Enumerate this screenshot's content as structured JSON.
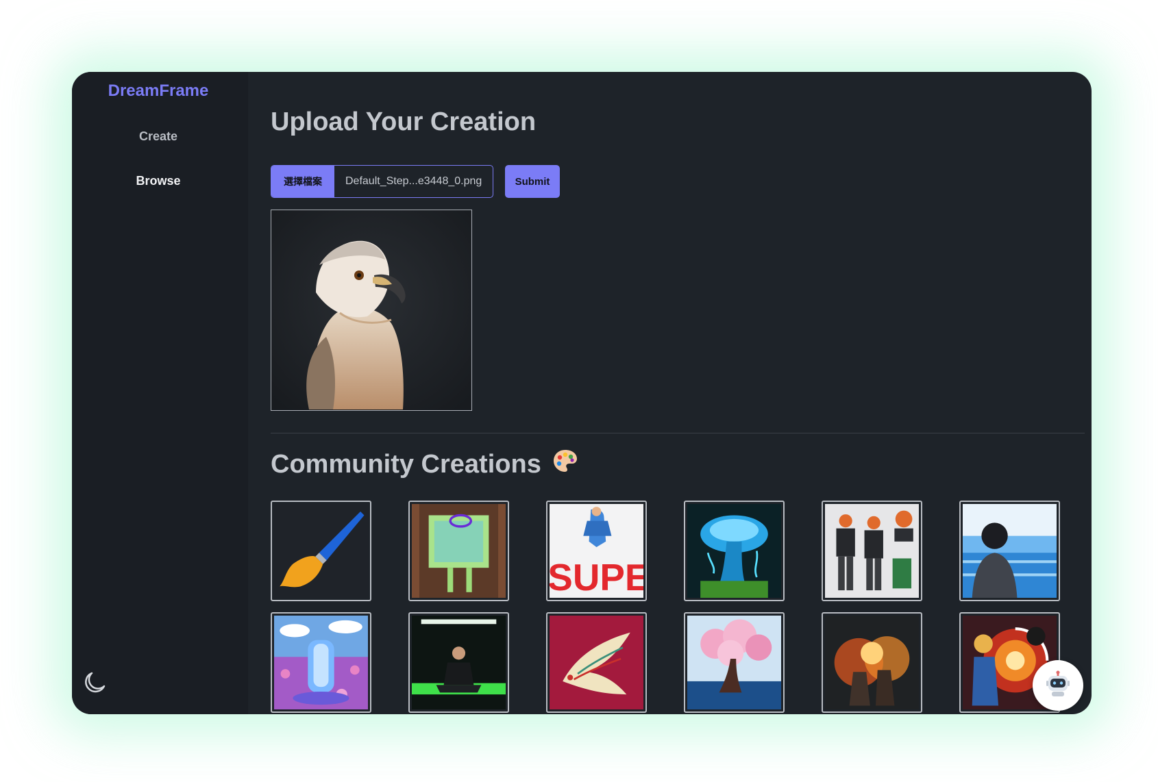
{
  "brand": {
    "name": "DreamFrame",
    "color": "#7b7cf6"
  },
  "nav": {
    "items": [
      {
        "label": "Create",
        "active": false
      },
      {
        "label": "Browse",
        "active": true
      }
    ]
  },
  "upload": {
    "title": "Upload Your Creation",
    "file_button_label": "選擇檔案",
    "file_name": "Default_Step...e3448_0.png",
    "submit_label": "Submit",
    "preview_image": "eagle-portrait"
  },
  "community": {
    "title": "Community Creations",
    "title_icon": "palette-icon",
    "thumbnails": [
      "paintbrush",
      "glowing-canvas-easel",
      "superhero-text",
      "glowing-mushroom",
      "anime-character-sheet",
      "boy-facing-sea",
      "crystal-flower-field",
      "man-meditating-neon-room",
      "ornate-bird-print",
      "cherry-blossom-tree",
      "fiery-warriors",
      "anime-fighters-swirl"
    ]
  },
  "icons": {
    "theme_toggle": "moon-icon",
    "assistant": "robot-icon"
  }
}
